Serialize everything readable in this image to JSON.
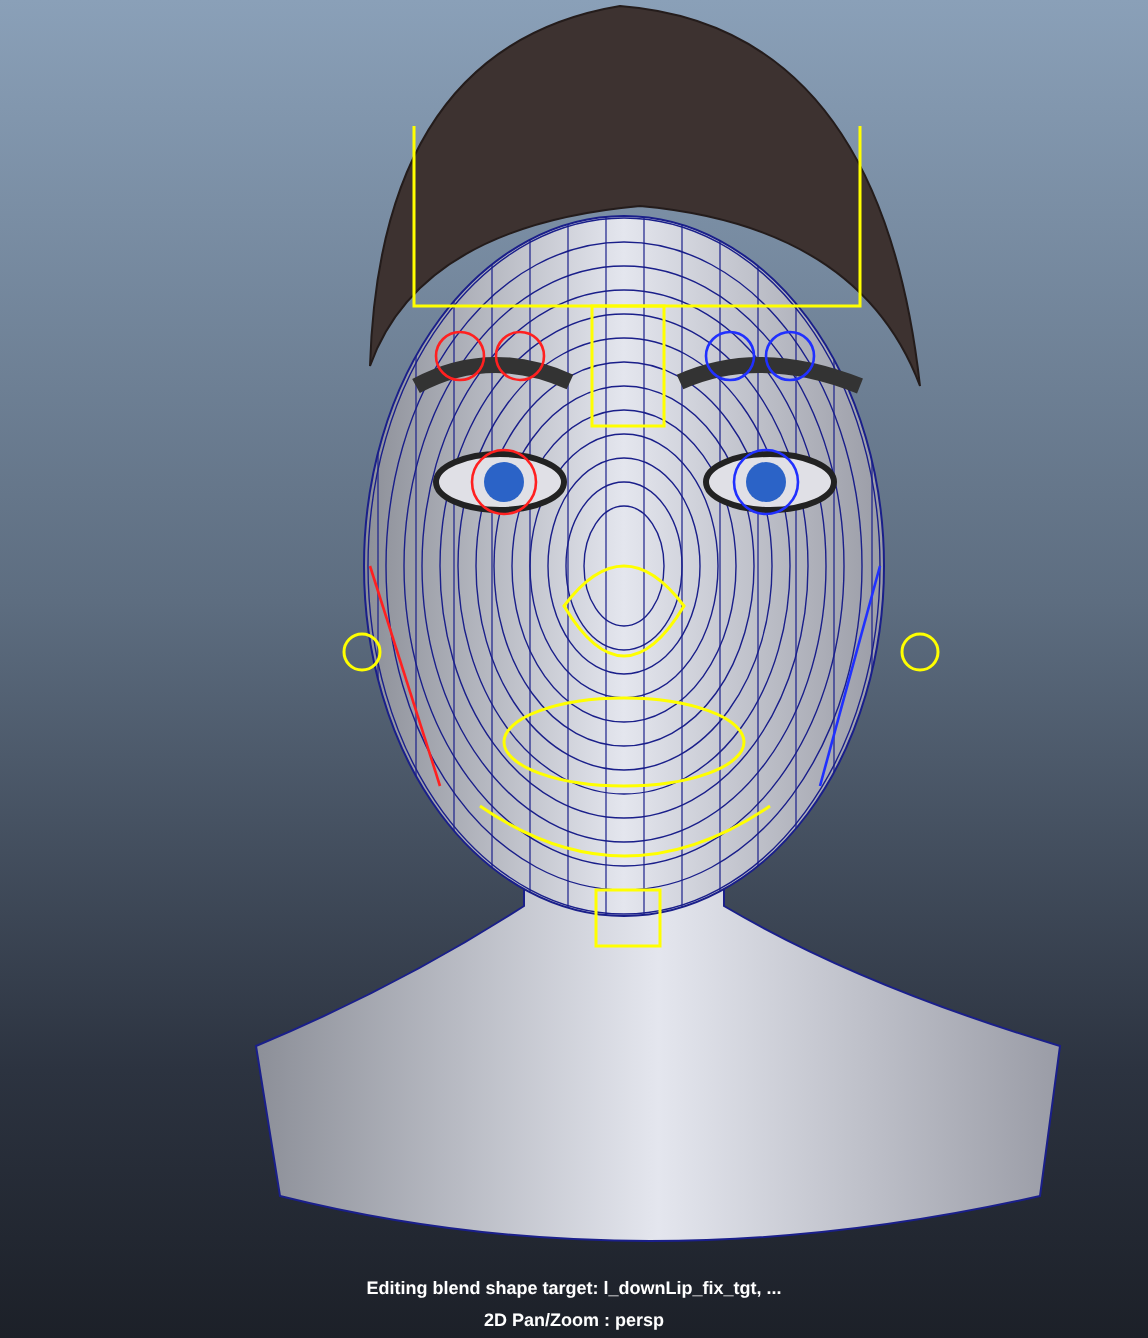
{
  "viewport": {
    "messages": [
      "Editing blend shape target: l_downLip_fix_tgt, ...",
      "2D Pan/Zoom : persp"
    ]
  }
}
